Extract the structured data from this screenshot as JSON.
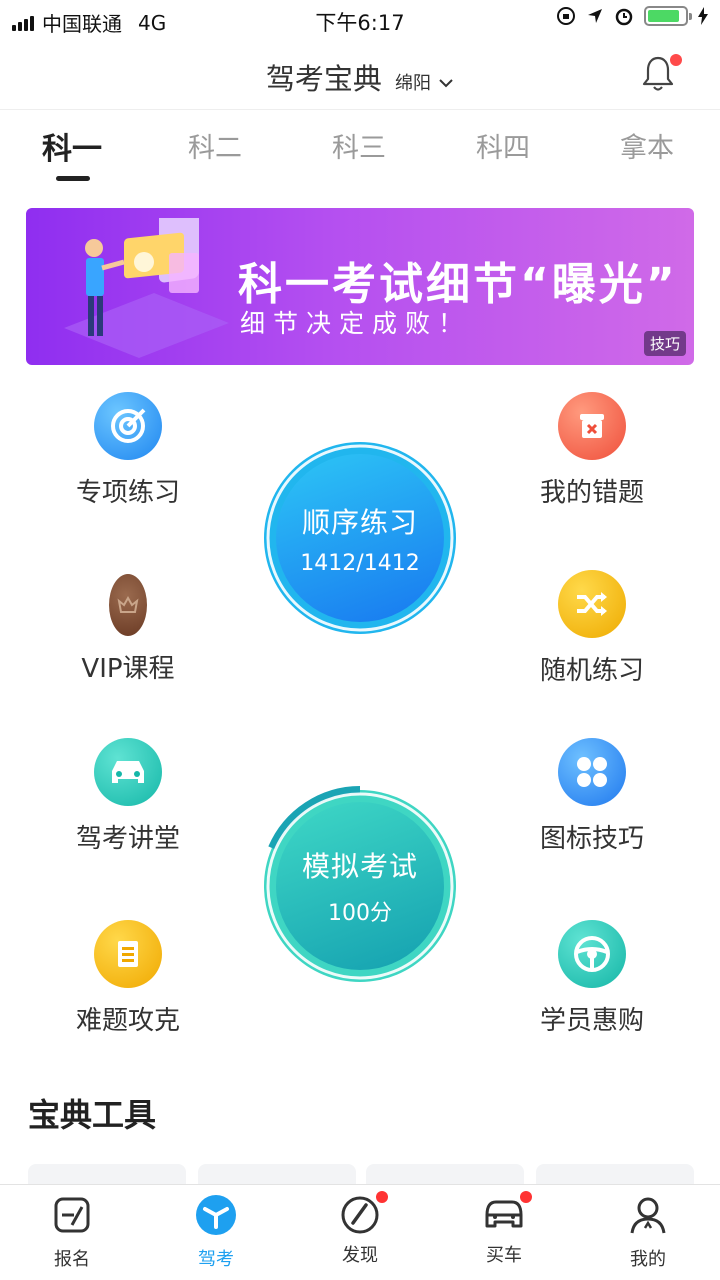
{
  "status_bar": {
    "carrier": "中国联通",
    "network": "4G",
    "time": "下午6:17"
  },
  "header": {
    "title": "驾考宝典",
    "city": "绵阳"
  },
  "tabs": [
    {
      "label": "科一",
      "active": true
    },
    {
      "label": "科二",
      "active": false
    },
    {
      "label": "科三",
      "active": false
    },
    {
      "label": "科四",
      "active": false
    },
    {
      "label": "拿本",
      "active": false
    }
  ],
  "banner": {
    "title": "科一考试细节“曝光”",
    "subtitle": "细节决定成败！",
    "tag": "技巧"
  },
  "features": {
    "special_practice": {
      "label": "专项练习",
      "icon": "target-icon",
      "color": "#2f9bf5"
    },
    "my_mistakes": {
      "label": "我的错题",
      "icon": "mistake-box-icon",
      "color": "#f56a4e"
    },
    "vip_course": {
      "label": "VIP课程",
      "icon": "vip-crown-icon",
      "color": "#7a4a32"
    },
    "random_practice": {
      "label": "随机练习",
      "icon": "shuffle-icon",
      "color": "#f2b412"
    },
    "driving_lecture": {
      "label": "驾考讲堂",
      "icon": "car-icon",
      "color": "#22c9b8"
    },
    "sign_tips": {
      "label": "图标技巧",
      "icon": "four-dots-icon",
      "color": "#2d8cf5"
    },
    "hard_questions": {
      "label": "难题攻克",
      "icon": "scroll-icon",
      "color": "#f5b10f"
    },
    "student_deals": {
      "label": "学员惠购",
      "icon": "steering-wheel-icon",
      "color": "#1fc6b9"
    }
  },
  "sequential_practice": {
    "title": "顺序练习",
    "progress_text": "1412/1412",
    "progress": 1.0
  },
  "mock_exam": {
    "title": "模拟考试",
    "score_text": "100分"
  },
  "tools": {
    "title": "宝典工具"
  },
  "bottom_nav": [
    {
      "label": "报名",
      "icon": "signup-icon",
      "active": false,
      "badge": false
    },
    {
      "label": "驾考",
      "icon": "drive-exam-icon",
      "active": true,
      "badge": false
    },
    {
      "label": "发现",
      "icon": "compass-icon",
      "active": false,
      "badge": true
    },
    {
      "label": "买车",
      "icon": "buy-car-icon",
      "active": false,
      "badge": true
    },
    {
      "label": "我的",
      "icon": "profile-icon",
      "active": false,
      "badge": false
    }
  ],
  "colors": {
    "accent": "#1ea0f0",
    "badge": "#ff3b3b",
    "banner_start": "#8f2ef0",
    "banner_end": "#d06ae8"
  }
}
